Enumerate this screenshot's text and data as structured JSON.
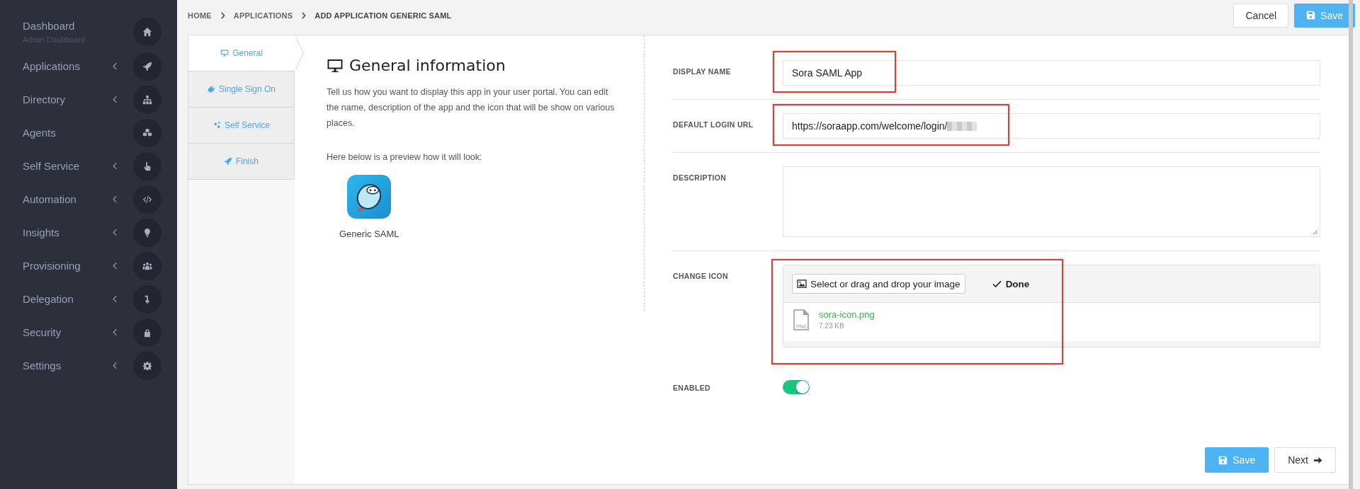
{
  "sidebar": {
    "items": [
      {
        "label": "Dashboard",
        "subtitle": "Admin Dashboard",
        "has_submenu": false
      },
      {
        "label": "Applications",
        "has_submenu": true
      },
      {
        "label": "Directory",
        "has_submenu": true
      },
      {
        "label": "Agents",
        "has_submenu": false
      },
      {
        "label": "Self Service",
        "has_submenu": true
      },
      {
        "label": "Automation",
        "has_submenu": true
      },
      {
        "label": "Insights",
        "has_submenu": true
      },
      {
        "label": "Provisioning",
        "has_submenu": true
      },
      {
        "label": "Delegation",
        "has_submenu": true
      },
      {
        "label": "Security",
        "has_submenu": true
      },
      {
        "label": "Settings",
        "has_submenu": true
      }
    ]
  },
  "breadcrumb": [
    "HOME",
    "APPLICATIONS",
    "ADD APPLICATION GENERIC SAML"
  ],
  "header_buttons": [
    {
      "label": "Cancel",
      "kind": "plain"
    },
    {
      "label": "Save",
      "kind": "primary"
    }
  ],
  "tabs": [
    {
      "label": "General",
      "selected": true
    },
    {
      "label": "Single Sign On",
      "selected": false
    },
    {
      "label": "Self Service",
      "selected": false
    },
    {
      "label": "Finish",
      "selected": false
    }
  ],
  "info": {
    "title": "General information",
    "description": "Tell us how you want to display this app in your user portal. You can edit the name, description of the app and the icon that will be show on various places.",
    "preview_caption": "Here below is a preview how it will look:",
    "app_name": "Generic SAML"
  },
  "form": [
    {
      "kind": "text",
      "label": "DISPLAY NAME",
      "value": "Sora SAML App",
      "highlighted": true
    },
    {
      "kind": "text",
      "label": "DEFAULT LOGIN URL",
      "value": "https://soraapp.com/welcome/login/",
      "redacted": true,
      "highlighted": true
    },
    {
      "kind": "textarea",
      "label": "DESCRIPTION",
      "highlighted": false
    },
    {
      "kind": "upload",
      "label": "CHANGE ICON",
      "button": "Select or drag and drop your image",
      "done": "Done",
      "file_name": "sora-icon.png",
      "file_type": "PNG",
      "file_size": "7.23 KB",
      "highlighted": true
    },
    {
      "kind": "toggle",
      "label": "ENABLED",
      "on": true
    }
  ],
  "footer_buttons": [
    {
      "label": "Save",
      "kind": "primary"
    },
    {
      "label": "Next",
      "kind": "next"
    }
  ]
}
